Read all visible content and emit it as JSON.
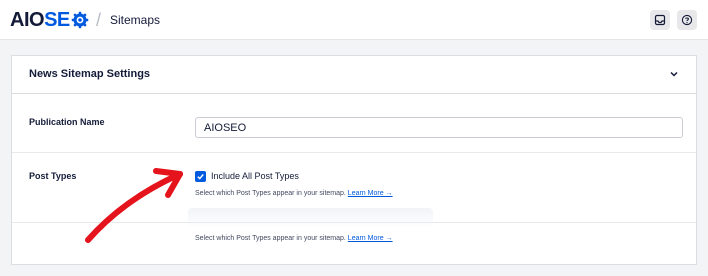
{
  "header": {
    "logo_text_dark": "AIO",
    "logo_text_blue": "SE",
    "logo_text_dark2": "",
    "breadcrumb_separator": "/",
    "breadcrumb": "Sitemaps",
    "icons": [
      "inbox-icon",
      "help-icon"
    ]
  },
  "card": {
    "title": "News Sitemap Settings",
    "publication_name_label": "Publication Name",
    "publication_name_value": "AIOSEO",
    "post_types_label": "Post Types",
    "include_all_label": "Include All Post Types",
    "include_all_checked": true,
    "help_text": "Select which Post Types appear in your sitemap.",
    "learn_more": "Learn More →",
    "help_text_2": "Select which Post Types appear in your sitemap.",
    "learn_more_2": "Learn More →"
  },
  "colors": {
    "accent": "#005ae0",
    "annotation_arrow": "#e5141c"
  }
}
